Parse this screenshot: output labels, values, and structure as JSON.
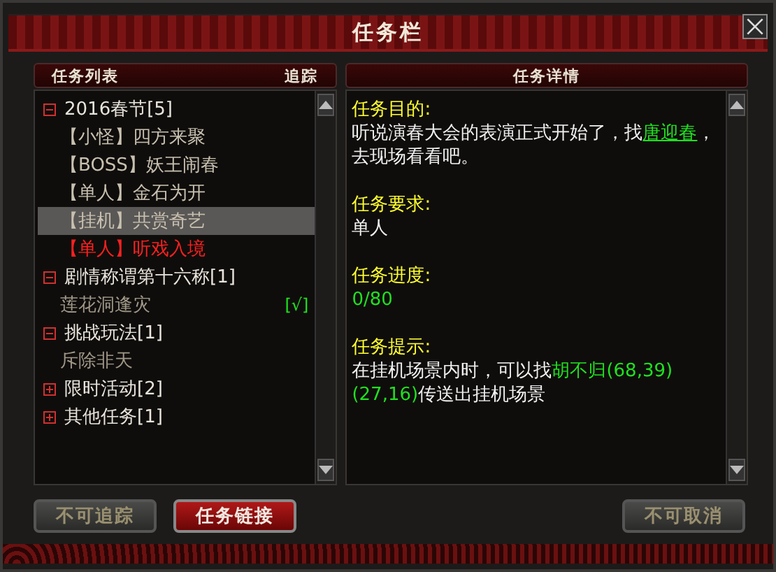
{
  "window": {
    "title": "任务栏"
  },
  "quest_list": {
    "header": "任务列表",
    "track_header": "追踪",
    "groups": [
      {
        "label": "2016春节[5]",
        "expanded": true,
        "children": [
          {
            "label": "【小怪】四方来聚",
            "selected": false,
            "color": "#c8c0b0"
          },
          {
            "label": "【BOSS】妖王闹春",
            "selected": false,
            "color": "#c8c0b0"
          },
          {
            "label": "【单人】金石为开",
            "selected": false,
            "color": "#c8c0b0"
          },
          {
            "label": "【挂机】共赏奇艺",
            "selected": true,
            "color": "#c8c0b0"
          },
          {
            "label": "【单人】听戏入境",
            "selected": false,
            "color": "#ff2020"
          }
        ]
      },
      {
        "label": "剧情称谓第十六称[1]",
        "expanded": true,
        "children": [
          {
            "label": "莲花洞逢灾",
            "selected": false,
            "color": "#a09888",
            "track": "[√]"
          }
        ]
      },
      {
        "label": "挑战玩法[1]",
        "expanded": true,
        "children": [
          {
            "label": "斥除非天",
            "selected": false,
            "color": "#a09888"
          }
        ]
      },
      {
        "label": "限时活动[2]",
        "expanded": false
      },
      {
        "label": "其他任务[1]",
        "expanded": false
      }
    ]
  },
  "details": {
    "header": "任务详情",
    "sections": [
      {
        "label": "任务目的:",
        "body": [
          {
            "kind": "plain",
            "text": "听说演春大会的表演正式开始了，找"
          },
          {
            "kind": "link",
            "text": "唐迎春"
          },
          {
            "kind": "plain",
            "text": "，去现场看看吧。"
          }
        ]
      },
      {
        "label": "任务要求:",
        "body": [
          {
            "kind": "plain",
            "text": "单人"
          }
        ]
      },
      {
        "label": "任务进度:",
        "body": [
          {
            "kind": "green",
            "text": "0/80"
          }
        ]
      },
      {
        "label": "任务提示:",
        "body": [
          {
            "kind": "plain",
            "text": "在挂机场景内时，可以找"
          },
          {
            "kind": "green",
            "text": "胡不归(68,39)(27,16)"
          },
          {
            "kind": "plain",
            "text": "传送出挂机场景"
          }
        ]
      }
    ]
  },
  "buttons": [
    {
      "label": "不可追踪",
      "disabled": true
    },
    {
      "label": "任务链接",
      "disabled": false
    },
    {
      "label": "不可取消",
      "disabled": true
    }
  ]
}
